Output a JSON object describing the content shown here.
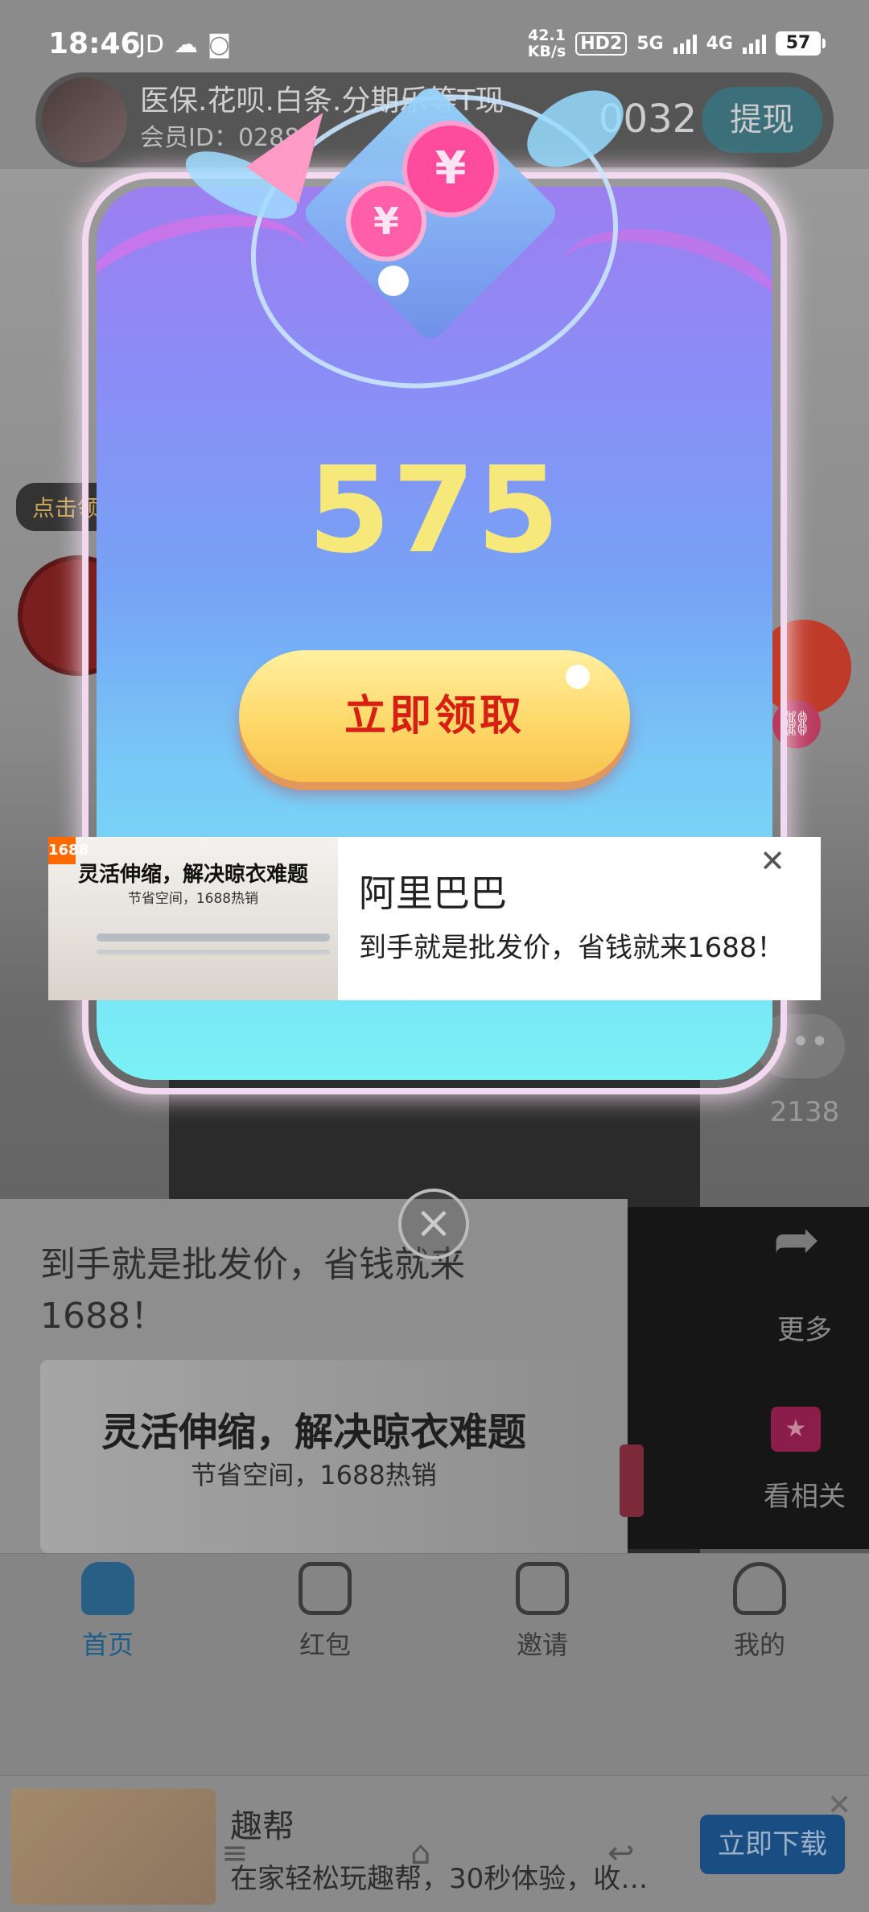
{
  "status_bar": {
    "time": "18:46",
    "left_icons": [
      "JD",
      "wechat-icon",
      "app-icon"
    ],
    "net_speed": "42.1",
    "net_speed_unit": "KB/s",
    "hd_label": "HD2",
    "network_5g": "5G",
    "network_4g": "4G",
    "battery": "57"
  },
  "user_bar": {
    "title": "医保.花呗.白条.分期乐等T现",
    "member_id": "会员ID：02884",
    "number": "0032",
    "withdraw_label": "提现"
  },
  "left_float": {
    "tip": "点击领"
  },
  "right_rail": {
    "link_icon": "link-icon",
    "comment_count": "2138",
    "more_label": "更多",
    "related_label": "看相关"
  },
  "feed_ad": {
    "text": "到手就是批发价，省钱就来1688！",
    "image_title": "灵活伸缩，解决晾衣难题",
    "image_subtitle": "节省空间，1688热销"
  },
  "popup": {
    "coin_glyph_1": "¥",
    "coin_glyph_2": "¥",
    "amount": "575",
    "claim_label": "立即领取",
    "accent": "#f6e87a",
    "claim_text_color": "#d81f14"
  },
  "native_ad": {
    "logo": "1688",
    "thumb_title": "灵活伸缩，解决晾衣难题",
    "thumb_subtitle": "节省空间，1688热销",
    "title": "阿里巴巴",
    "description": "到手就是批发价，省钱就来1688！"
  },
  "bottom_nav": {
    "items": [
      {
        "label": "首页",
        "icon": "home-icon",
        "active": true
      },
      {
        "label": "红包",
        "icon": "red-packet-icon",
        "active": false
      },
      {
        "label": "邀请",
        "icon": "invite-icon",
        "active": false
      },
      {
        "label": "我的",
        "icon": "profile-icon",
        "active": false
      }
    ]
  },
  "download_banner": {
    "title": "趣帮",
    "description": "在家轻松玩趣帮，30秒体验，收…",
    "button": "立即下载"
  }
}
